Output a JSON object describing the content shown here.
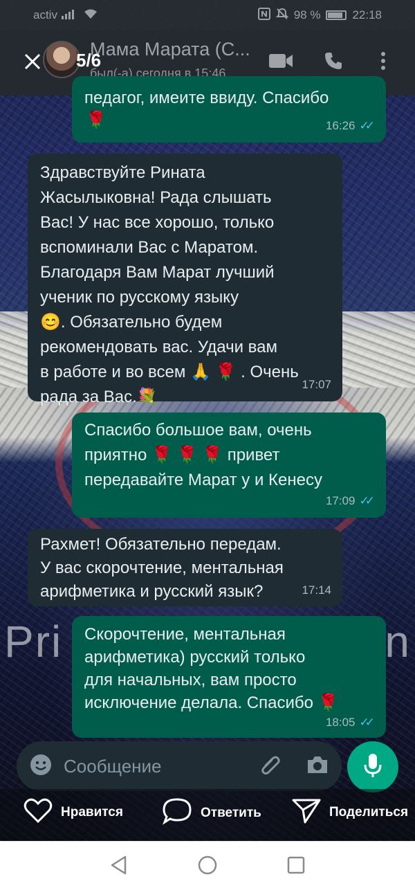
{
  "status_bar": {
    "carrier": "activ",
    "battery_percent": "98 %",
    "time": "22:18"
  },
  "header": {
    "counter": "5/6",
    "contact_name": "Мама Марата (С...",
    "last_seen": "был(-а) сегодня в 15:46"
  },
  "messages": [
    {
      "direction": "out",
      "text": "педагог, имеите ввиду. Спасибо",
      "emoji": "rose",
      "time": "16:26",
      "status": "read"
    },
    {
      "direction": "in",
      "line1": "Здравствуйте Рината",
      "line2": "Жасылыковна! Рада слышать",
      "line3": "Вас! У нас все хорошо, только",
      "line4": "вспоминали Вас с Маратом.",
      "line5": "Благодаря Вам Марат лучший",
      "line6": "ученик по русскому языку",
      "line7": ". Обязательно будем",
      "line8": "рекомендовать вас. Удачи вам",
      "line9a": "в работе и во всем",
      "line9b": ". Очень",
      "line10": "рада за Вас.",
      "time": "17:07"
    },
    {
      "direction": "out",
      "line1": "Спасибо большое вам, очень",
      "line2a": "приятно",
      "line2b": "привет",
      "line3": "передавайте Марат у и Кенесу",
      "time": "17:09",
      "status": "read"
    },
    {
      "direction": "in",
      "line1": "Рахмет! Обязательно передам.",
      "line2": "У вас скорочтение, ментальная",
      "line3": "арифметика и русский язык?",
      "time": "17:14"
    },
    {
      "direction": "out",
      "line1": "Скорочтение, ментальная",
      "line2": "арифметика) русский только",
      "line3": "для начальных, вам просто",
      "line4": "исключение делала. Спасибо",
      "time": "18:05",
      "status": "read"
    }
  ],
  "composer": {
    "placeholder": "Сообщение"
  },
  "actions": {
    "like": "Нравится",
    "reply": "Ответить",
    "share": "Поделиться"
  },
  "background_text": {
    "left": "Pri",
    "right": "n"
  },
  "colors": {
    "incoming_bubble": "#1f2c33",
    "outgoing_bubble": "#005c4b",
    "accent": "#00a884",
    "read_ticks": "#53bdeb"
  }
}
